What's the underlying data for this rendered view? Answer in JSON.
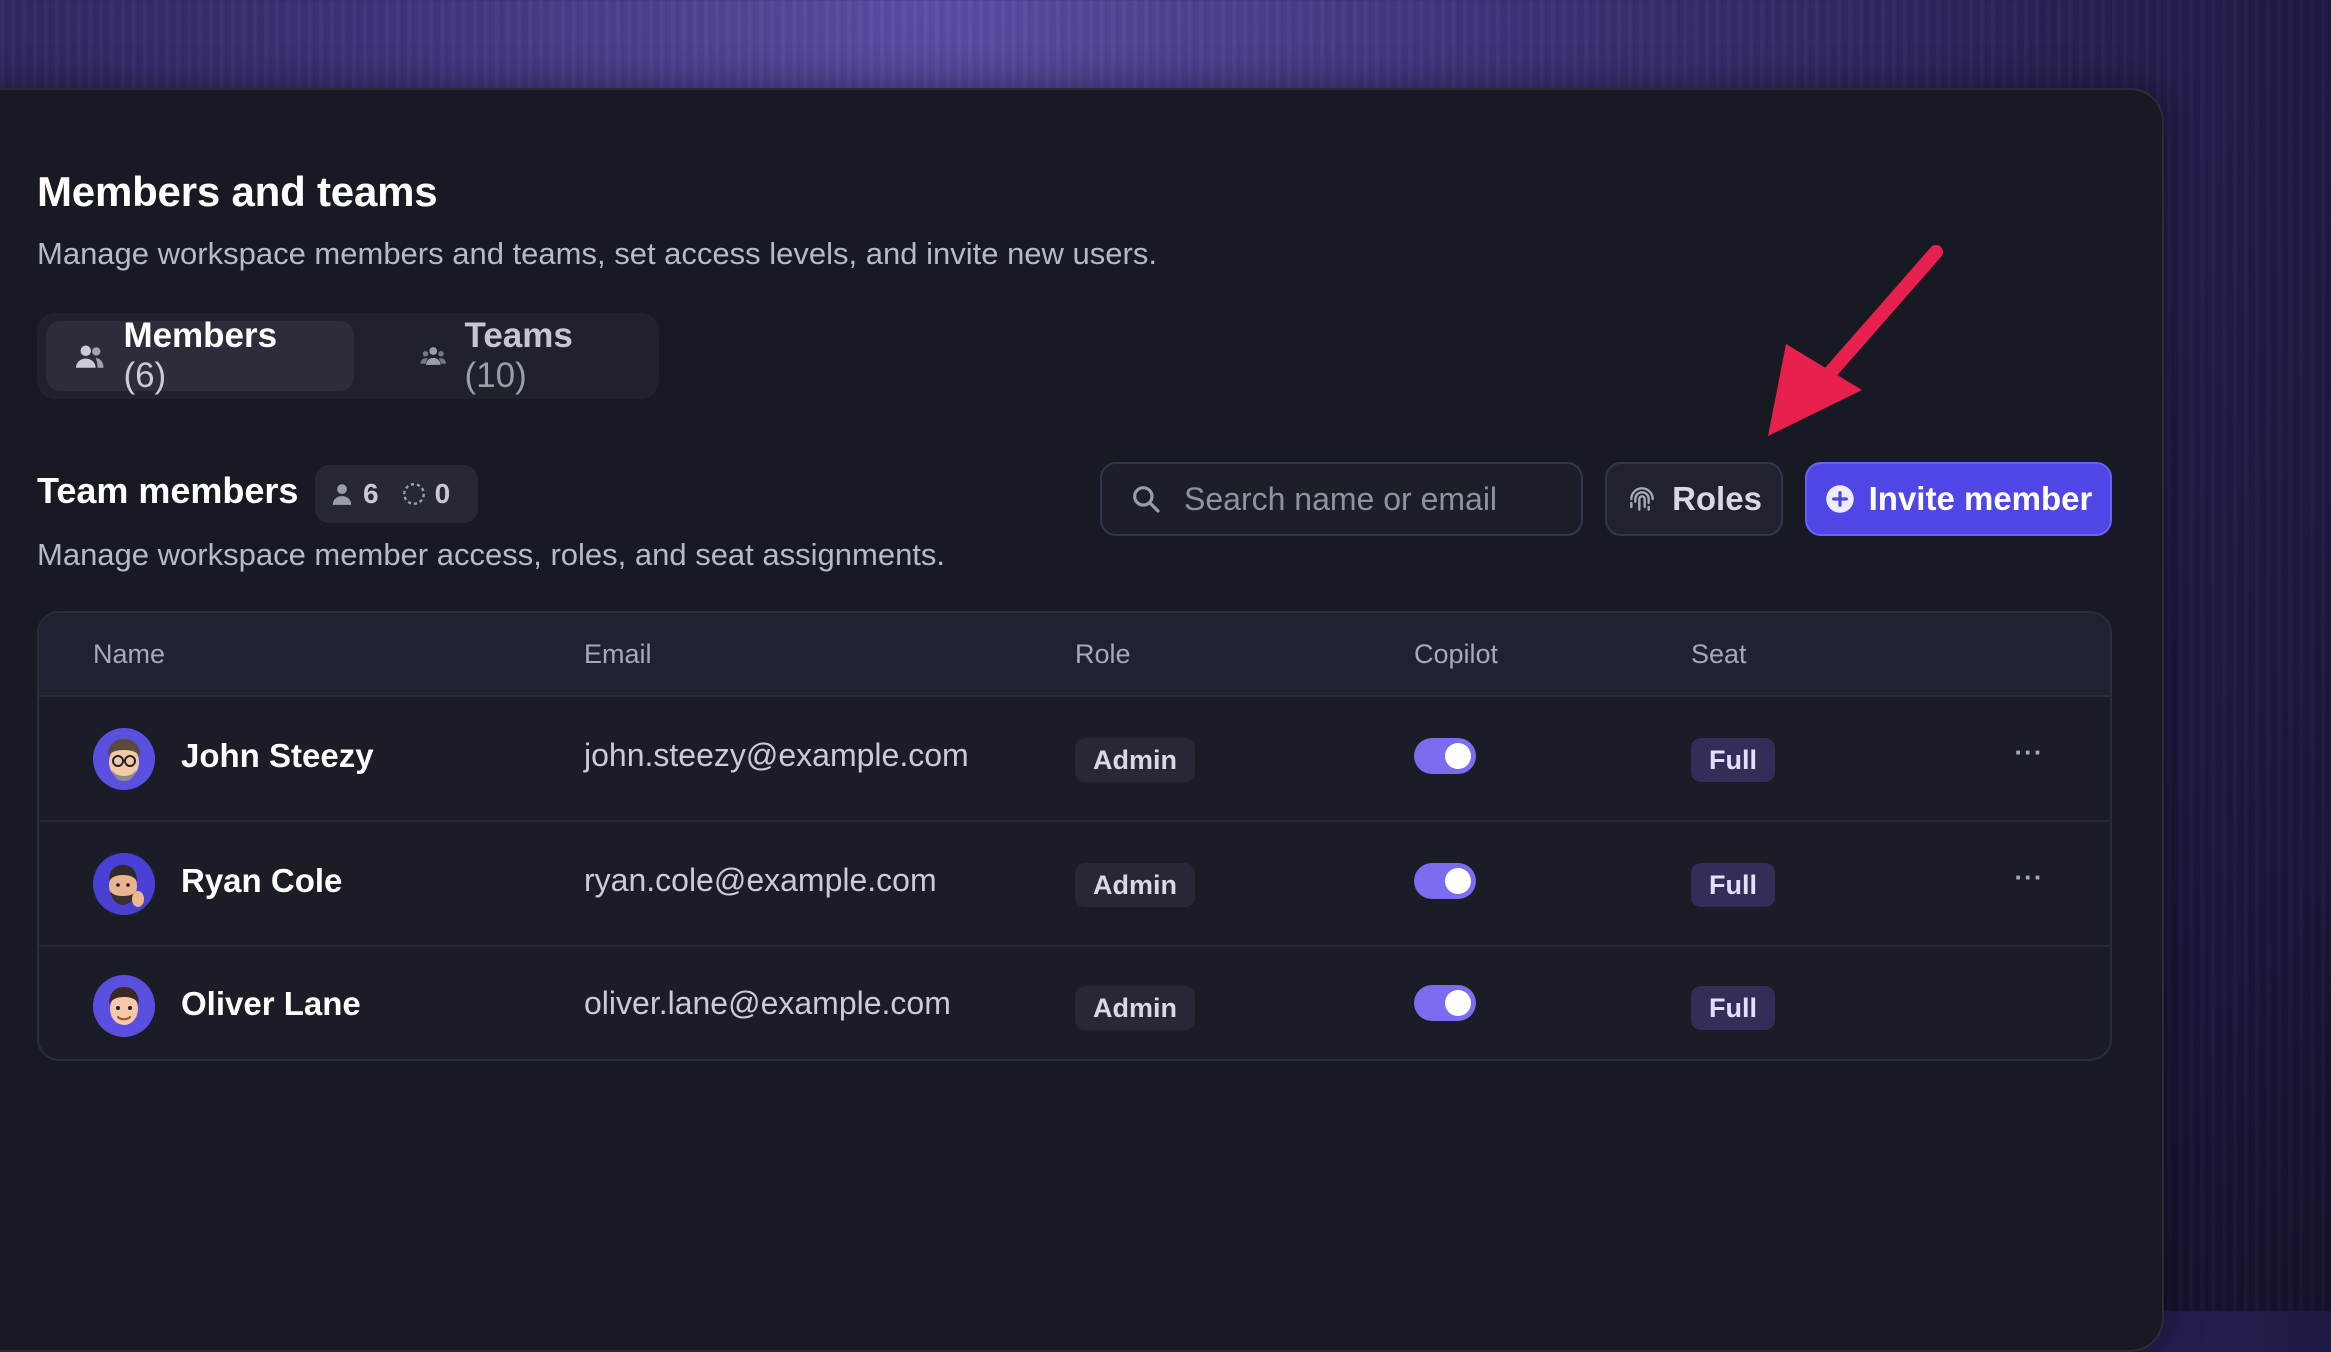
{
  "header": {
    "title": "Members and teams",
    "subtitle": "Manage workspace members and teams, set access levels, and invite new users."
  },
  "tabs": [
    {
      "label": "Members",
      "count": "(6)",
      "icon": "users-icon",
      "active": true
    },
    {
      "label": "Teams",
      "count": "(10)",
      "icon": "team-icon",
      "active": false
    }
  ],
  "section": {
    "title": "Team members",
    "active_count": "6",
    "pending_count": "0",
    "subtitle": "Manage workspace member access, roles, and seat assignments."
  },
  "search": {
    "placeholder": "Search name or email",
    "value": ""
  },
  "buttons": {
    "roles": "Roles",
    "invite": "Invite member"
  },
  "table": {
    "columns": [
      "Name",
      "Email",
      "Role",
      "Copilot",
      "Seat"
    ],
    "rows": [
      {
        "name": "John Steezy",
        "email": "john.steezy@example.com",
        "role": "Admin",
        "copilot": true,
        "seat": "Full",
        "more": "···"
      },
      {
        "name": "Ryan Cole",
        "email": "ryan.cole@example.com",
        "role": "Admin",
        "copilot": true,
        "seat": "Full",
        "more": "···"
      },
      {
        "name": "Oliver Lane",
        "email": "oliver.lane@example.com",
        "role": "Admin",
        "copilot": true,
        "seat": "Full"
      }
    ]
  },
  "colors": {
    "accent": "#4f46e5",
    "toggle_on": "#7b6cf0",
    "annotation_arrow": "#e8204e",
    "panel_bg": "#181a23"
  }
}
